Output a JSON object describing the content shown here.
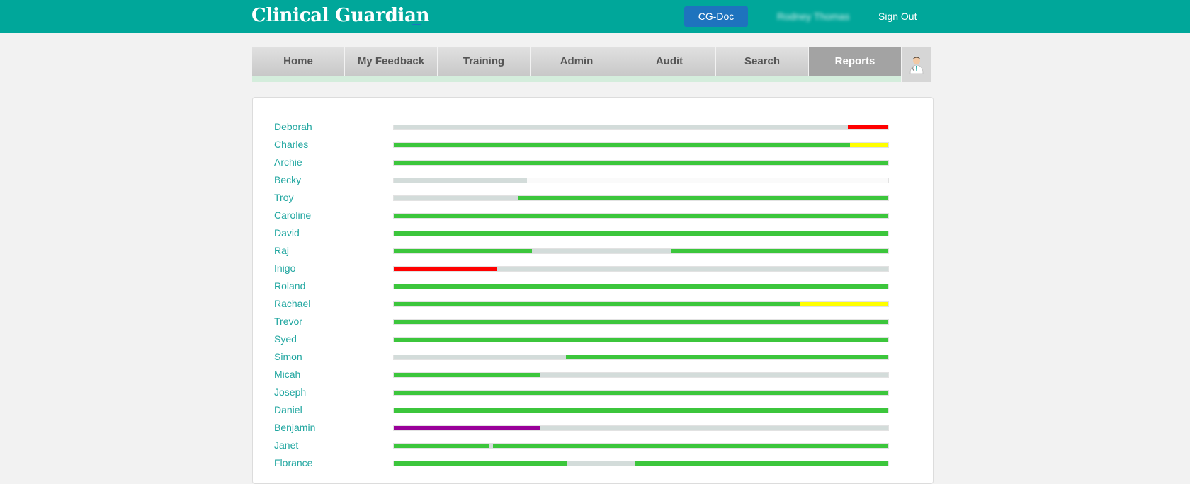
{
  "header": {
    "brand": "Clinical Guardian",
    "cgdoc_label": "CG-Doc",
    "username": "Rodney Thomas",
    "signout_label": "Sign Out"
  },
  "nav": {
    "tabs": [
      {
        "label": "Home"
      },
      {
        "label": "My Feedback"
      },
      {
        "label": "Training"
      },
      {
        "label": "Admin"
      },
      {
        "label": "Audit"
      },
      {
        "label": "Search"
      },
      {
        "label": "Reports",
        "active": true
      }
    ]
  },
  "colors": {
    "green": "#3cc63c",
    "grey": "#d3dcda",
    "red": "#ff0000",
    "yellow": "#ffff00",
    "purple": "#990099",
    "empty": "#fafafa",
    "teal": "#00a79a",
    "link": "#20a6a0"
  },
  "report": {
    "rows": [
      {
        "name": "Deborah",
        "segments": [
          [
            "grey",
            91.8
          ],
          [
            "red",
            8.2
          ]
        ]
      },
      {
        "name": "Charles",
        "segments": [
          [
            "green",
            92.3
          ],
          [
            "yellow",
            7.7
          ]
        ]
      },
      {
        "name": "Archie",
        "segments": [
          [
            "green",
            100
          ]
        ]
      },
      {
        "name": "Becky",
        "segments": [
          [
            "grey",
            27
          ],
          [
            "empty",
            73
          ]
        ]
      },
      {
        "name": "Troy",
        "segments": [
          [
            "grey",
            25.2
          ],
          [
            "green",
            74.8
          ]
        ]
      },
      {
        "name": "Caroline",
        "segments": [
          [
            "green",
            100
          ]
        ]
      },
      {
        "name": "David",
        "segments": [
          [
            "green",
            100
          ]
        ]
      },
      {
        "name": "Raj",
        "segments": [
          [
            "green",
            28
          ],
          [
            "grey",
            28.2
          ],
          [
            "green",
            43.8
          ]
        ]
      },
      {
        "name": "Inigo",
        "segments": [
          [
            "red",
            20.9
          ],
          [
            "grey",
            79.1
          ]
        ]
      },
      {
        "name": "Roland",
        "segments": [
          [
            "green",
            100
          ]
        ]
      },
      {
        "name": "Rachael",
        "segments": [
          [
            "green",
            82.1
          ],
          [
            "yellow",
            17.9
          ]
        ]
      },
      {
        "name": "Trevor",
        "segments": [
          [
            "green",
            100
          ]
        ]
      },
      {
        "name": "Syed",
        "segments": [
          [
            "green",
            100
          ]
        ]
      },
      {
        "name": "Simon",
        "segments": [
          [
            "grey",
            34.8
          ],
          [
            "green",
            65.2
          ]
        ]
      },
      {
        "name": "Micah",
        "segments": [
          [
            "green",
            29.7
          ],
          [
            "grey",
            70.3
          ]
        ]
      },
      {
        "name": "Joseph",
        "segments": [
          [
            "green",
            100
          ]
        ]
      },
      {
        "name": "Daniel",
        "segments": [
          [
            "green",
            100
          ]
        ]
      },
      {
        "name": "Benjamin",
        "segments": [
          [
            "purple",
            29.5
          ],
          [
            "grey",
            70.5
          ]
        ]
      },
      {
        "name": "Janet",
        "segments": [
          [
            "green",
            19.3
          ],
          [
            "grey",
            0.8
          ],
          [
            "green",
            79.9
          ]
        ]
      },
      {
        "name": "Florance",
        "segments": [
          [
            "green",
            35
          ],
          [
            "grey",
            13.8
          ],
          [
            "green",
            51.2
          ]
        ]
      }
    ]
  }
}
